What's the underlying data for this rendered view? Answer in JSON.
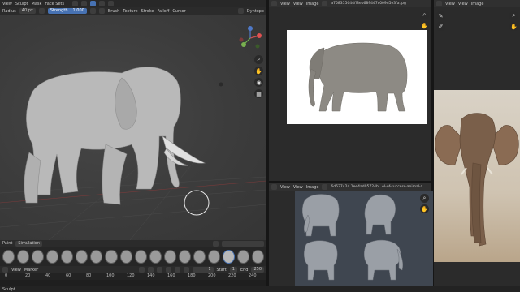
{
  "top_menu": [
    "View",
    "Sculpt",
    "Mask",
    "Face Sets"
  ],
  "viewport_header": {
    "radius_label": "Radius",
    "radius_value": "40 px",
    "strength_label": "Strength",
    "strength_value": "1.000",
    "menus": [
      "Brush",
      "Texture",
      "Stroke",
      "Falloff",
      "Cursor"
    ],
    "right_label": "Dyntopo"
  },
  "bottom_tabs": [
    "Paint",
    "Simulation"
  ],
  "timeline": {
    "menus": [
      "View",
      "Marker"
    ],
    "current_frame": "1",
    "start_label": "Start",
    "start_value": "1",
    "end_label": "End",
    "end_value": "250",
    "ruler": [
      "0",
      "20",
      "40",
      "60",
      "80",
      "100",
      "120",
      "140",
      "160",
      "180",
      "200",
      "220",
      "240"
    ]
  },
  "image_editor_top": {
    "menus": [
      "View",
      "View",
      "Image"
    ],
    "filename": "a758355644ff8eb689447c009d5e3fa.jpg"
  },
  "image_editor_bottom": {
    "menus": [
      "View",
      "View",
      "Image"
    ],
    "filename": "6d637424 1ee4ad05724b...el-of-success-animal-a..."
  },
  "right_panel": {
    "menus": [
      "View",
      "View",
      "Image"
    ]
  },
  "status": {
    "text": "Sculpt"
  },
  "colors": {
    "accent": "#4772b3",
    "panel": "#303030",
    "viewport_bg": "#3c3c3c"
  },
  "icons": {
    "zoom": "magnifier-icon",
    "pan": "hand-icon",
    "camera": "camera-icon",
    "gizmo": "navigation-gizmo-icon",
    "eyedropper": "eyedropper-icon"
  }
}
